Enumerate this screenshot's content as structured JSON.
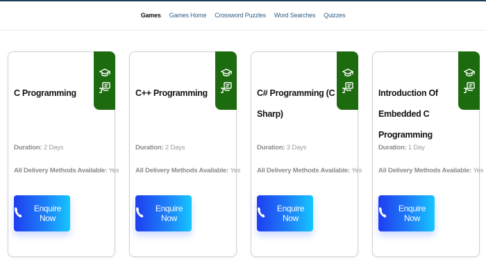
{
  "nav": {
    "items": [
      {
        "label": "Games",
        "active": true
      },
      {
        "label": "Games Home",
        "active": false
      },
      {
        "label": "Crossword Puzzles",
        "active": false
      },
      {
        "label": "Word Searches",
        "active": false
      },
      {
        "label": "Quizzes",
        "active": false
      }
    ]
  },
  "colors": {
    "badge": "#1d6b0f",
    "button_start": "#1e3df0",
    "button_end": "#15c7ff",
    "nav_link": "#2f5d86"
  },
  "icons": [
    "graduation-cap-icon",
    "certificate-hand-icon",
    "phone-icon"
  ],
  "labels": {
    "duration": "Duration:",
    "delivery": "All Delivery Methods Available:",
    "enquire": "Enquire Now"
  },
  "courses": [
    {
      "title": "C Programming",
      "duration": "2 Days",
      "delivery": "Yes"
    },
    {
      "title": "C++ Programming",
      "duration": "2 Days",
      "delivery": "Yes"
    },
    {
      "title": "C# Programming (C Sharp)",
      "duration": "3 Days",
      "delivery": "Yes"
    },
    {
      "title": "Introduction Of Embedded C Programming",
      "duration": "1 Day",
      "delivery": "Yes"
    }
  ]
}
